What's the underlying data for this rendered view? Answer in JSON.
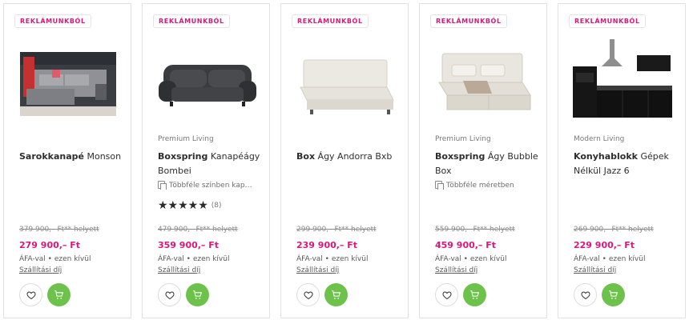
{
  "accent_color": "#d8197b",
  "cart_color": "#6cc24a",
  "products": [
    {
      "badge": "REKLÁMUNKBÓL",
      "image_icon": "corner-sofa-image",
      "brand": "",
      "title_bold": "Sarokkanapé",
      "title_rest": " Monson",
      "variant": "",
      "rating_stars": "",
      "rating_count": "",
      "old_price": "379 900,– Ft** helyett",
      "price": "279 900,– Ft",
      "vat": "ÁFA-val • ezen kívül",
      "shipping": "Szállítási díj",
      "fav_icon": "heart-icon",
      "cart_icon": "cart-icon"
    },
    {
      "badge": "REKLÁMUNKBÓL",
      "image_icon": "sofa-bed-image",
      "brand": "Premium Living",
      "title_bold": "Boxspring",
      "title_rest": " Kanapéágy Bombei",
      "variant": "Többféle színben kap…",
      "rating_stars": "★★★★★",
      "rating_count": "(8)",
      "old_price": "479 900,– Ft** helyett",
      "price": "359 900,– Ft",
      "vat": "ÁFA-val • ezen kívül",
      "shipping": "Szállítási díj",
      "fav_icon": "heart-icon",
      "cart_icon": "cart-icon"
    },
    {
      "badge": "REKLÁMUNKBÓL",
      "image_icon": "box-bed-image",
      "brand": "",
      "title_bold": "Box",
      "title_rest": " Ágy Andorra Bxb",
      "variant": "",
      "rating_stars": "",
      "rating_count": "",
      "old_price": "299 900,– Ft** helyett",
      "price": "239 900,– Ft",
      "vat": "ÁFA-val • ezen kívül",
      "shipping": "Szállítási díj",
      "fav_icon": "heart-icon",
      "cart_icon": "cart-icon"
    },
    {
      "badge": "REKLÁMUNKBÓL",
      "image_icon": "boxspring-bed-image",
      "brand": "Premium Living",
      "title_bold": "Boxspring",
      "title_rest": " Ágy Bubble Box",
      "variant": "Többféle méretben",
      "rating_stars": "",
      "rating_count": "",
      "old_price": "559 900,– Ft** helyett",
      "price": "459 900,– Ft",
      "vat": "ÁFA-val • ezen kívül",
      "shipping": "Szállítási díj",
      "fav_icon": "heart-icon",
      "cart_icon": "cart-icon"
    },
    {
      "badge": "REKLÁMUNKBÓL",
      "image_icon": "kitchen-block-image",
      "brand": "Modern Living",
      "title_bold": "Konyhablokk",
      "title_rest": " Gépek Nélkül Jazz 6",
      "variant": "",
      "rating_stars": "",
      "rating_count": "",
      "old_price": "269 900,– Ft** helyett",
      "price": "229 900,– Ft",
      "vat": "ÁFA-val • ezen kívül",
      "shipping": "Szállítási díj",
      "fav_icon": "heart-icon",
      "cart_icon": "cart-icon"
    }
  ]
}
